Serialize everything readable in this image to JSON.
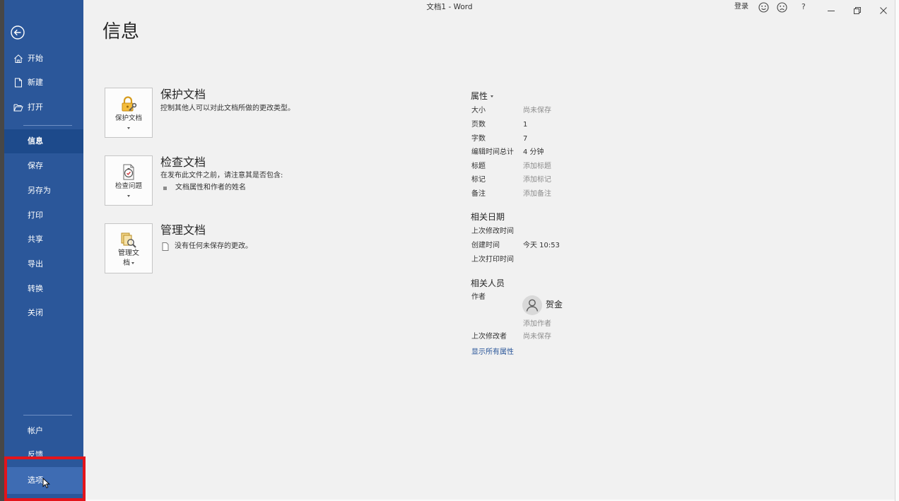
{
  "window": {
    "title": "文档1 - Word",
    "sign_in": "登录",
    "help_label": "?",
    "icons": [
      "smiley-icon",
      "frown-icon",
      "minimize-icon",
      "restore-icon",
      "close-icon"
    ]
  },
  "sidebar": {
    "back_icon": "back-arrow-icon",
    "top_items": [
      {
        "label": "开始",
        "icon": "home-icon"
      },
      {
        "label": "新建",
        "icon": "new-document-icon"
      },
      {
        "label": "打开",
        "icon": "open-folder-icon"
      }
    ],
    "items": [
      {
        "label": "信息",
        "selected": true
      },
      {
        "label": "保存"
      },
      {
        "label": "另存为"
      },
      {
        "label": "打印"
      },
      {
        "label": "共享"
      },
      {
        "label": "导出"
      },
      {
        "label": "转换"
      },
      {
        "label": "关闭"
      }
    ],
    "bottom_items": [
      {
        "label": "帐户"
      },
      {
        "label": "反馈"
      },
      {
        "label": "选项",
        "hovered": true
      }
    ]
  },
  "main": {
    "title": "信息",
    "sections": [
      {
        "icon": "lock-icon",
        "button_label": "保护文档",
        "title": "保护文档",
        "description": "控制其他人可以对此文档所做的更改类型。"
      },
      {
        "icon": "inspect-document-icon",
        "button_label": "检查问题",
        "title": "检查文档",
        "description": "在发布此文件之前，请注意其是否包含:",
        "bullets": [
          "文档属性和作者的姓名"
        ]
      },
      {
        "icon": "manage-document-icon",
        "button_label": "管理文档",
        "title": "管理文档",
        "status": "没有任何未保存的更改。"
      }
    ]
  },
  "properties": {
    "heading": "属性",
    "rows": [
      {
        "label": "大小",
        "value": "尚未保存",
        "placeholder": true
      },
      {
        "label": "页数",
        "value": "1"
      },
      {
        "label": "字数",
        "value": "7"
      },
      {
        "label": "编辑时间总计",
        "value": "4 分钟"
      },
      {
        "label": "标题",
        "value": "添加标题",
        "placeholder": true
      },
      {
        "label": "标记",
        "value": "添加标记",
        "placeholder": true
      },
      {
        "label": "备注",
        "value": "添加备注",
        "placeholder": true
      }
    ],
    "dates_heading": "相关日期",
    "dates": [
      {
        "label": "上次修改时间"
      },
      {
        "label": "创建时间",
        "value": "今天 10:53"
      },
      {
        "label": "上次打印时间"
      }
    ],
    "people_heading": "相关人员",
    "author_label": "作者",
    "author_name": "贺金",
    "add_author": "添加作者",
    "last_modified_by_label": "上次修改者",
    "last_modified_by_value": "尚未保存",
    "show_all": "显示所有属性"
  },
  "colors": {
    "sidebar": "#2b579a",
    "sidebar_selected": "#1d4a8b",
    "sidebar_hover": "#3e6cb3",
    "link": "#2b579a",
    "annotation_box": "#e3141b",
    "lock": "#f4bc3a"
  }
}
